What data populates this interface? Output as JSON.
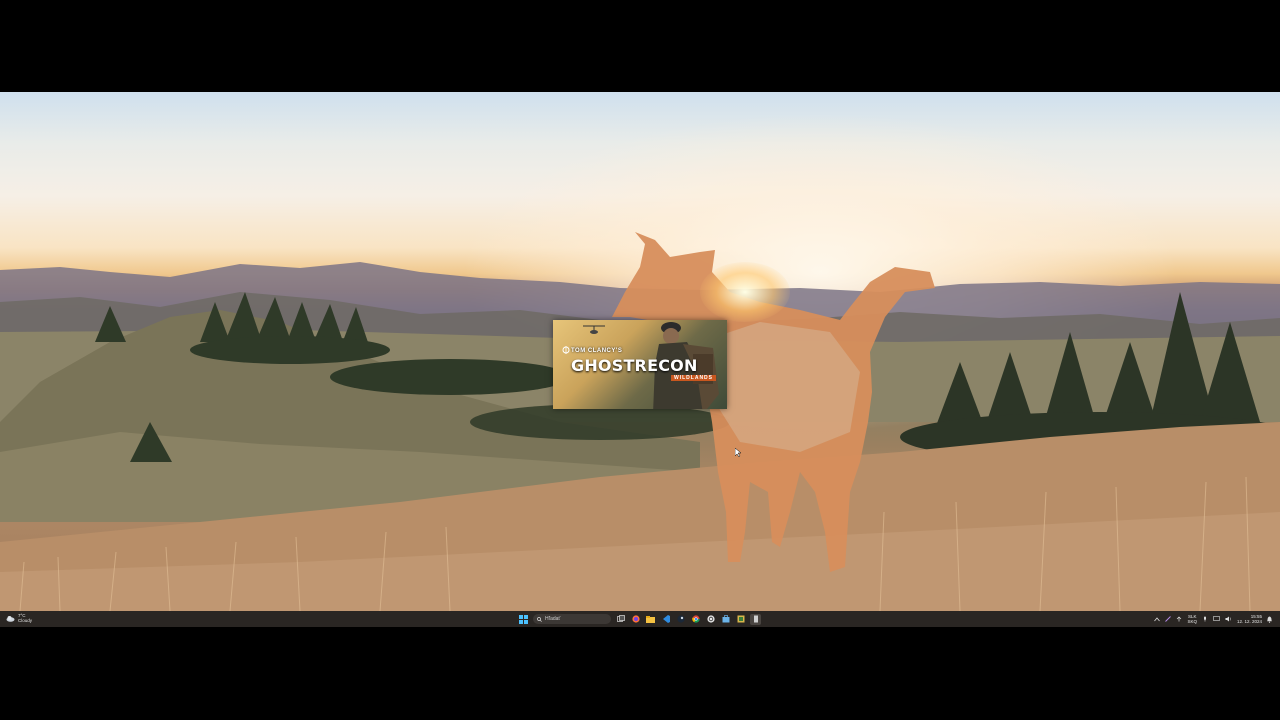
{
  "game_splash": {
    "publisher_line": "TOM CLANCY'S",
    "title": "GHOSTRECON",
    "subtitle": "WILDLANDS"
  },
  "taskbar": {
    "weather": {
      "temperature": "7°C",
      "condition": "Cloudy"
    },
    "search": {
      "placeholder": "Hľadať"
    },
    "pinned_icons": [
      "windows-start-icon",
      "search-icon",
      "task-view-icon",
      "firefox-icon",
      "file-explorer-icon",
      "vscode-icon",
      "steam-icon",
      "chrome-icon",
      "ubisoft-icon",
      "store-icon",
      "game-icon",
      "app-icon"
    ],
    "tray": {
      "language_top": "SLK",
      "language_bottom": "SKQ",
      "time": "15:55",
      "date": "12. 12. 2024"
    }
  },
  "colors": {
    "taskbar_bg": "#2a2623",
    "accent": "#c8571f"
  }
}
